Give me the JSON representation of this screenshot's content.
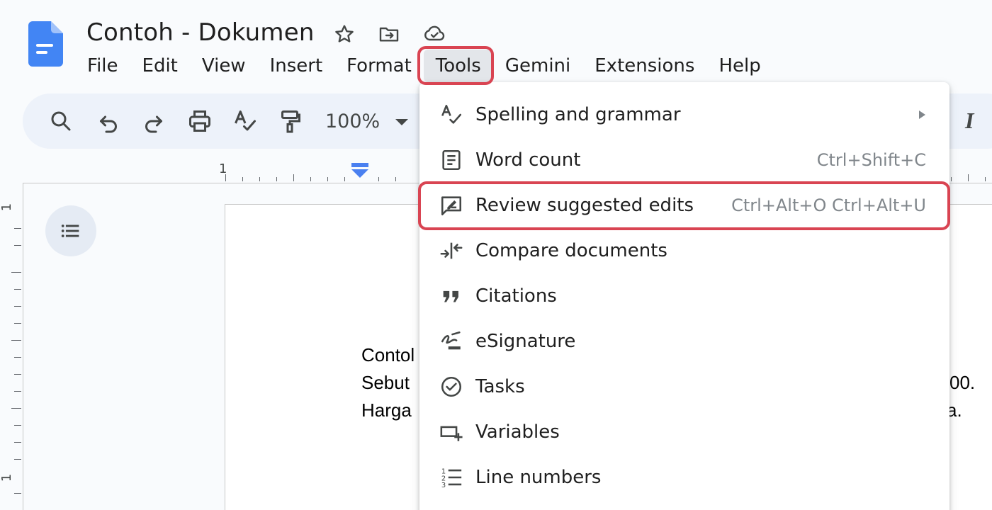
{
  "document": {
    "title": "Contoh - Dokumen",
    "body_lines": [
      {
        "visible_start": "Contol",
        "visible_end": ""
      },
      {
        "visible_start": "Sebut",
        "visible_end": "00."
      },
      {
        "visible_start": "Harga",
        "visible_end": "a."
      }
    ]
  },
  "menubar": {
    "items": [
      "File",
      "Edit",
      "View",
      "Insert",
      "Format",
      "Tools",
      "Gemini",
      "Extensions",
      "Help"
    ],
    "active": "Tools"
  },
  "toolbar": {
    "zoom": "100%",
    "italic_label": "I"
  },
  "ruler": {
    "h_label": "1",
    "v_label_top": "1",
    "v_label_bottom": "1"
  },
  "tools_menu": {
    "items": [
      {
        "label": "Spelling and grammar",
        "shortcut": "",
        "submenu": true,
        "icon": "spelling-icon"
      },
      {
        "label": "Word count",
        "shortcut": "Ctrl+Shift+C",
        "submenu": false,
        "icon": "word-count-icon"
      },
      {
        "label": "Review suggested edits",
        "shortcut": "Ctrl+Alt+O Ctrl+Alt+U",
        "submenu": false,
        "icon": "review-edits-icon",
        "highlighted": true
      },
      {
        "label": "Compare documents",
        "shortcut": "",
        "submenu": false,
        "icon": "compare-icon"
      },
      {
        "label": "Citations",
        "shortcut": "",
        "submenu": false,
        "icon": "quote-icon"
      },
      {
        "label": "eSignature",
        "shortcut": "",
        "submenu": false,
        "icon": "signature-icon"
      },
      {
        "label": "Tasks",
        "shortcut": "",
        "submenu": false,
        "icon": "check-circle-icon"
      },
      {
        "label": "Variables",
        "shortcut": "",
        "submenu": false,
        "icon": "variables-icon"
      },
      {
        "label": "Line numbers",
        "shortcut": "",
        "submenu": false,
        "icon": "line-numbers-icon"
      }
    ]
  },
  "colors": {
    "highlight": "#d94452",
    "docs_blue": "#4285f4",
    "toolbar_bg": "#edf2fa",
    "shortcut_text": "#80868b"
  }
}
